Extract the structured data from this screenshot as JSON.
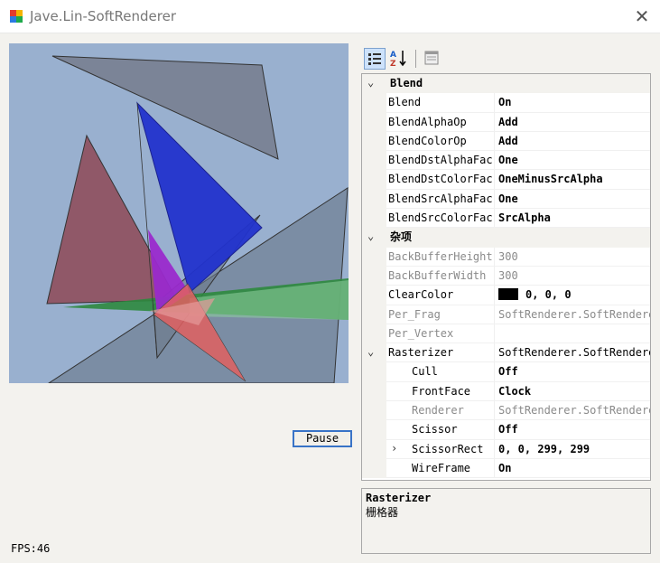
{
  "window": {
    "title": "Jave.Lin-SoftRenderer"
  },
  "controls": {
    "pause_label": "Pause",
    "fps": "FPS:46"
  },
  "colors": {
    "viewport_bg": "#99b0cf",
    "accent": "#3873c7",
    "clear_swatch": "#000000"
  },
  "toolbar": {
    "categorized_icon": "categorized-icon",
    "alphabetical_icon": "alphabetical-icon",
    "property_pages_icon": "property-pages-icon"
  },
  "property_grid": {
    "rows": [
      {
        "kind": "category",
        "name": "Blend",
        "expanded": true
      },
      {
        "kind": "prop",
        "name": "Blend",
        "value": "On",
        "bold": true
      },
      {
        "kind": "prop",
        "name": "BlendAlphaOp",
        "value": "Add",
        "bold": true
      },
      {
        "kind": "prop",
        "name": "BlendColorOp",
        "value": "Add",
        "bold": true
      },
      {
        "kind": "prop",
        "name": "BlendDstAlphaFac",
        "value": "One",
        "bold": true
      },
      {
        "kind": "prop",
        "name": "BlendDstColorFac",
        "value": "OneMinusSrcAlpha",
        "bold": true
      },
      {
        "kind": "prop",
        "name": "BlendSrcAlphaFac",
        "value": "One",
        "bold": true
      },
      {
        "kind": "prop",
        "name": "BlendSrcColorFac",
        "value": "SrcAlpha",
        "bold": true
      },
      {
        "kind": "category",
        "name": "杂项",
        "expanded": true
      },
      {
        "kind": "prop",
        "name": "BackBufferHeight",
        "value": "300",
        "dim": true
      },
      {
        "kind": "prop",
        "name": "BackBufferWidth",
        "value": "300",
        "dim": true
      },
      {
        "kind": "prop",
        "name": "ClearColor",
        "value": "0, 0, 0",
        "bold": true,
        "swatch": true
      },
      {
        "kind": "prop",
        "name": "Per_Frag",
        "value": "SoftRenderer.SoftRenderer",
        "dim": true
      },
      {
        "kind": "prop",
        "name": "Per_Vertex",
        "value": "",
        "dim": true
      },
      {
        "kind": "prop",
        "name": "Rasterizer",
        "value": "SoftRenderer.SoftRenderer",
        "expander": "expanded"
      },
      {
        "kind": "prop",
        "name": "Cull",
        "value": "Off",
        "bold": true,
        "sub": true
      },
      {
        "kind": "prop",
        "name": "FrontFace",
        "value": "Clock",
        "bold": true,
        "sub": true
      },
      {
        "kind": "prop",
        "name": "Renderer",
        "value": "SoftRenderer.SoftRenderer",
        "dim": true,
        "sub": true
      },
      {
        "kind": "prop",
        "name": "Scissor",
        "value": "Off",
        "bold": true,
        "sub": true
      },
      {
        "kind": "prop",
        "name": "ScissorRect",
        "value": "0, 0, 299, 299",
        "bold": true,
        "sub": true,
        "expander": "collapsed"
      },
      {
        "kind": "prop",
        "name": "WireFrame",
        "value": "On",
        "bold": true,
        "sub": true
      }
    ]
  },
  "description": {
    "title": "Rasterizer",
    "text": "栅格器"
  }
}
